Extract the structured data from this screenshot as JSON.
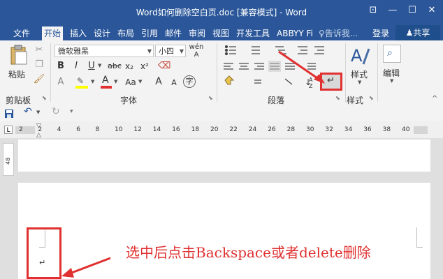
{
  "window": {
    "title": "Word如何删除空白页.doc [兼容模式] - Word",
    "controls": {
      "ribbon_options": "⊡",
      "minimize": "—",
      "maximize": "☐",
      "close": "✕"
    }
  },
  "tabs": [
    {
      "label": "文件"
    },
    {
      "label": "开始",
      "active": true
    },
    {
      "label": "插入"
    },
    {
      "label": "设计"
    },
    {
      "label": "布局"
    },
    {
      "label": "引用"
    },
    {
      "label": "邮件"
    },
    {
      "label": "审阅"
    },
    {
      "label": "视图"
    },
    {
      "label": "开发工具"
    },
    {
      "label": "ABBYY Fi"
    }
  ],
  "tell_me": {
    "placeholder": "告诉我..."
  },
  "account": {
    "login": "登录",
    "share": "共享"
  },
  "clipboard": {
    "paste": "粘贴",
    "group": "剪贴板"
  },
  "font": {
    "name": "微软雅黑",
    "size": "小四",
    "group": "字体",
    "buttons": {
      "bold": "B",
      "italic": "I",
      "underline": "U",
      "strike": "abc",
      "sub": "x₂",
      "sup": "x²",
      "aa": "Aa",
      "grow": "A",
      "shrink": "A",
      "phonetic": "wén",
      "enclose": "字"
    }
  },
  "paragraph": {
    "group": "段落"
  },
  "styles": {
    "label": "样式",
    "group": "样式"
  },
  "editing": {
    "label": "编辑"
  },
  "ruler": {
    "ticks": [
      "2",
      "2",
      "4",
      "6",
      "8",
      "10",
      "12",
      "14",
      "16",
      "18",
      "20",
      "22",
      "24",
      "26",
      "28",
      "30",
      "32",
      "34",
      "36",
      "38",
      "40"
    ]
  },
  "vertical_ruler": {
    "label": "48"
  },
  "document": {
    "paragraph_mark": "↵"
  },
  "annotation": {
    "text": "选中后点击Backspace或者delete删除"
  },
  "colors": {
    "title_bar": "#2b579a",
    "annotation": "#e03030",
    "highlight": "#ffff00",
    "font_color": "#e03030"
  }
}
